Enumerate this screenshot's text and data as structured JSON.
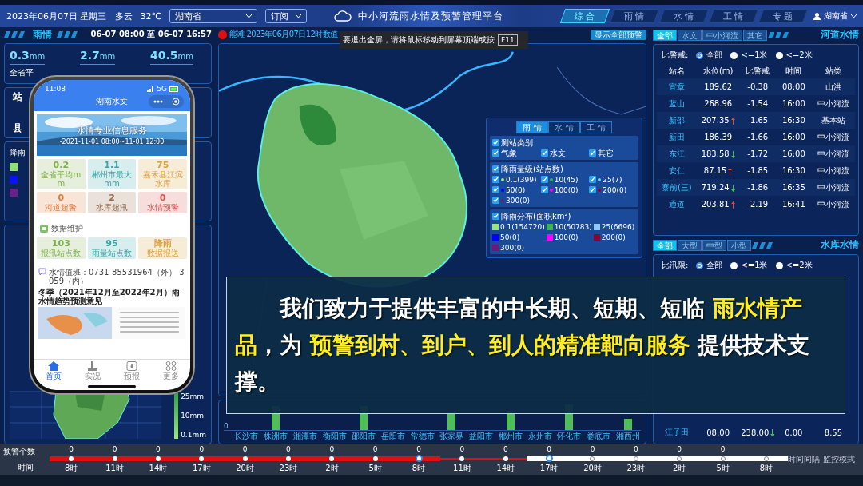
{
  "header": {
    "date": "2023年06月07日 星期三",
    "weather": "多云",
    "temperature": "32℃",
    "region_select": "湖南省",
    "subscribe": "订阅",
    "title": "中小河流雨水情及预警管理平台",
    "nav": [
      {
        "label": "综 合",
        "selected": true
      },
      {
        "label": "雨 情",
        "selected": false
      },
      {
        "label": "水 情",
        "selected": false
      },
      {
        "label": "工 情",
        "selected": false
      },
      {
        "label": "专 题",
        "selected": false
      }
    ],
    "user": "湖南省"
  },
  "fullscreen_tip": {
    "text": "要退出全屏，请将鼠标移动到屏幕顶端或按",
    "key": "F11"
  },
  "rain_panel": {
    "title": "雨情",
    "period": "06-07 08:00 至 06-07 16:57",
    "stats": [
      {
        "value": "0.3",
        "unit": "mm",
        "label": "全省平"
      },
      {
        "value": "2.7",
        "unit": "mm"
      },
      {
        "value": "40.5",
        "unit": "mm"
      }
    ],
    "station_labels": [
      "站",
      "县"
    ],
    "legend_title": "降雨",
    "legend": [
      {
        "color": "#8fe07a"
      },
      {
        "color": "#0a14f0"
      },
      {
        "color": "#6b1f8a"
      }
    ],
    "map_scale": [
      "25mm",
      "10mm",
      "0.1mm"
    ]
  },
  "alert": {
    "text": "能滩 2023年06月07日12时数值",
    "show_all": "显示全部预警"
  },
  "filter": {
    "tabs": [
      {
        "label": "雨 情",
        "selected": true
      },
      {
        "label": "水 情",
        "selected": false
      },
      {
        "label": "工 情",
        "selected": false
      }
    ],
    "groups": [
      {
        "kind": "plain",
        "title": "测站类别",
        "checked": true,
        "items": [
          {
            "label": "气象",
            "checked": true
          },
          {
            "label": "水文",
            "checked": true
          },
          {
            "label": "其它",
            "checked": true
          }
        ]
      },
      {
        "kind": "dot",
        "title": "降雨量级(站点数)",
        "checked": true,
        "items": [
          {
            "label": "0.1(399)",
            "checked": true,
            "color": "#9be37a"
          },
          {
            "label": "10(45)",
            "checked": true,
            "color": "#3cb44b"
          },
          {
            "label": "25(7)",
            "checked": true,
            "color": "#7fc7ff"
          },
          {
            "label": "50(0)",
            "checked": true,
            "color": "#0000ff"
          },
          {
            "label": "100(0)",
            "checked": true,
            "color": "#ff00ff"
          },
          {
            "label": "200(0)",
            "checked": true,
            "color": "#8b0030"
          },
          {
            "label": "300(0)",
            "checked": true,
            "color": "#6a1b7a"
          }
        ]
      },
      {
        "kind": "square",
        "title": "降雨分布(面积km²)",
        "checked": true,
        "items": [
          {
            "label": "0.1(154720)",
            "color": "#9be37a"
          },
          {
            "label": "10(50783)",
            "color": "#3cb44b"
          },
          {
            "label": "25(6696)",
            "color": "#8fc8ff"
          },
          {
            "label": "50(0)",
            "color": "#0000ff"
          },
          {
            "label": "100(0)",
            "color": "#ff00ff"
          },
          {
            "label": "200(0)",
            "color": "#8b0030"
          },
          {
            "label": "300(0)",
            "color": "#6a1b7a"
          }
        ]
      }
    ]
  },
  "city_labels": [
    "长沙市",
    "株洲市",
    "湘潭市",
    "衡阳市",
    "邵阳市",
    "岳阳市",
    "常德市",
    "张家界",
    "益阳市",
    "郴州市",
    "永州市",
    "怀化市",
    "娄底市",
    "湘西州"
  ],
  "chart_axis": "0",
  "river": {
    "tabs": [
      {
        "label": "全部",
        "selected": true
      },
      {
        "label": "水文",
        "selected": false
      },
      {
        "label": "中小河流",
        "selected": false
      },
      {
        "label": "其它",
        "selected": false
      }
    ],
    "title": "河道水情",
    "filter_label": "比警戒:",
    "filters": [
      {
        "label": "全部",
        "selected": true
      },
      {
        "label": "<=1米",
        "selected": false
      },
      {
        "label": "<=2米",
        "selected": false
      }
    ],
    "columns": [
      "站名",
      "水位(m)",
      "比警戒",
      "时间",
      "站类"
    ],
    "rows": [
      {
        "name": "宜章",
        "level": "189.62",
        "rising": false,
        "falling": false,
        "diff": "-0.38",
        "time": "08:00",
        "type": "山洪"
      },
      {
        "name": "蓝山",
        "level": "268.96",
        "rising": false,
        "falling": false,
        "diff": "-1.54",
        "time": "16:00",
        "type": "中小河流"
      },
      {
        "name": "新邵",
        "level": "207.35",
        "rising": true,
        "falling": false,
        "diff": "-1.65",
        "time": "16:30",
        "type": "基本站"
      },
      {
        "name": "新田",
        "level": "186.39",
        "rising": false,
        "falling": false,
        "diff": "-1.66",
        "time": "16:00",
        "type": "中小河流"
      },
      {
        "name": "东江",
        "level": "183.58",
        "rising": false,
        "falling": true,
        "diff": "-1.72",
        "time": "16:00",
        "type": "中小河流"
      },
      {
        "name": "安仁",
        "level": "87.15",
        "rising": true,
        "falling": false,
        "diff": "-1.85",
        "time": "16:30",
        "type": "中小河流"
      },
      {
        "name": "寨前(三)",
        "level": "719.24",
        "rising": false,
        "falling": true,
        "diff": "-1.86",
        "time": "16:35",
        "type": "中小河流"
      },
      {
        "name": "通道",
        "level": "203.81",
        "rising": true,
        "falling": false,
        "diff": "-2.19",
        "time": "16:41",
        "type": "中小河流"
      }
    ]
  },
  "reservoir": {
    "tabs": [
      {
        "label": "全部",
        "selected": true
      },
      {
        "label": "大型",
        "selected": false
      },
      {
        "label": "中型",
        "selected": false
      },
      {
        "label": "小型",
        "selected": false
      }
    ],
    "title": "水库水情",
    "filter_label": "比汛限:",
    "filters": [
      {
        "label": "全部",
        "selected": true
      },
      {
        "label": "<=1米",
        "selected": false
      },
      {
        "label": "<=2米",
        "selected": false
      }
    ],
    "rows": [
      {
        "name": "江子田",
        "time": "08:00",
        "level": "238.00",
        "rising": false,
        "falling": true,
        "diff": "0.00",
        "storage": "8.55"
      }
    ]
  },
  "timeline": {
    "count_label": "预警个数",
    "time_label": "时间",
    "right_labels": [
      "时间间隔",
      "监控模式"
    ],
    "points": [
      {
        "time": "8时",
        "count": "0",
        "elapsed": true,
        "handle": false
      },
      {
        "time": "11时",
        "count": "0",
        "elapsed": true,
        "handle": false
      },
      {
        "time": "14时",
        "count": "0",
        "elapsed": true,
        "handle": false
      },
      {
        "time": "17时",
        "count": "0",
        "elapsed": true,
        "handle": false
      },
      {
        "time": "20时",
        "count": "0",
        "elapsed": true,
        "handle": false
      },
      {
        "time": "23时",
        "count": "0",
        "elapsed": true,
        "handle": false
      },
      {
        "time": "2时",
        "count": "0",
        "elapsed": true,
        "handle": false
      },
      {
        "time": "5时",
        "count": "0",
        "elapsed": true,
        "handle": false
      },
      {
        "time": "8时",
        "count": "0",
        "elapsed": true,
        "handle": true
      },
      {
        "time": "11时",
        "count": "0",
        "elapsed": true,
        "handle": false
      },
      {
        "time": "14时",
        "count": "0",
        "elapsed": true,
        "handle": false
      },
      {
        "time": "17时",
        "count": "0",
        "elapsed": false,
        "handle": true
      },
      {
        "time": "20时",
        "count": "0",
        "elapsed": false,
        "handle": false
      },
      {
        "time": "23时",
        "count": "0",
        "elapsed": false,
        "handle": false
      },
      {
        "time": "2时",
        "count": "0",
        "elapsed": false,
        "handle": false
      },
      {
        "time": "5时",
        "count": "0",
        "elapsed": false,
        "handle": false
      },
      {
        "time": "8时",
        "elapsed": false,
        "handle": false
      }
    ]
  },
  "phone": {
    "time": "11:08",
    "network": "5G",
    "title": "湖南水文",
    "banner_title": "水情专业信息服务",
    "banner_period": "-2021-11-01 08:00~11-01 12:00",
    "tiles": [
      {
        "value": "0.2",
        "label": "全省平均mm",
        "color": "#7fb04a"
      },
      {
        "value": "1.1",
        "label": "郴州市最大mm",
        "color": "#3aa6a6"
      },
      {
        "value": "75",
        "label": "嘉禾县江滨水库",
        "color": "#d9a23a"
      },
      {
        "value": "0",
        "label": "河道超警",
        "color": "#e07a3a"
      },
      {
        "value": "2",
        "label": "水库超汛",
        "color": "#9a6a4a"
      },
      {
        "value": "0",
        "label": "水情预警",
        "color": "#d9534f"
      }
    ],
    "section": "数据维护",
    "tiles2": [
      {
        "value": "103",
        "label": "报汛站点数",
        "color": "#7fb04a"
      },
      {
        "value": "95",
        "label": "雨量站点数",
        "color": "#3aa6a6"
      },
      {
        "value": "降雨",
        "label": "数据报送",
        "color": "#d9a23a"
      }
    ],
    "hotline": "水情值班：0731-85531964（外） 3059（内）",
    "doc_title": "冬季（2021年12月至2022年2月）雨水情趋势预测意见",
    "nav": [
      {
        "label": "首页",
        "selected": true
      },
      {
        "label": "实况",
        "selected": false
      },
      {
        "label": "预报",
        "selected": false
      },
      {
        "label": "更多",
        "selected": false
      }
    ]
  },
  "caption": "我们致力于提供丰富的中长期、短期、短临 **雨水情产品**，为 **预警到村、到户、到人的精准靶向服务** 提供技术支撑。"
}
